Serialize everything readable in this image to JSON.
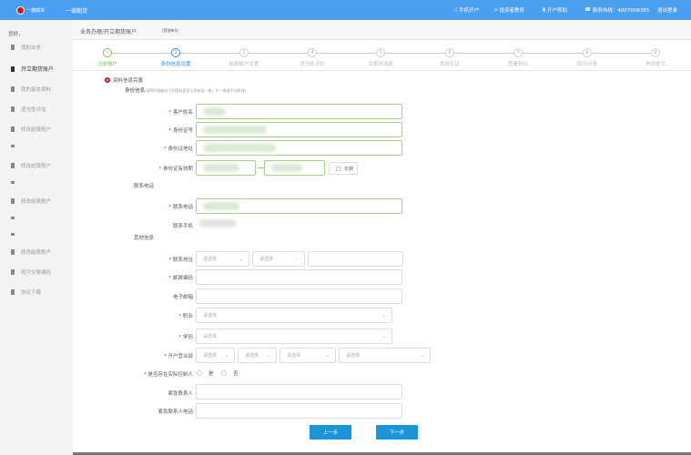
{
  "header": {
    "logo_text": "一德期货",
    "brand": "一德期货",
    "nav": [
      {
        "icon": "mobile-icon",
        "label": "手机开户"
      },
      {
        "icon": "home-icon",
        "label": "投资者教育"
      },
      {
        "icon": "book-icon",
        "label": "开户帮助"
      },
      {
        "icon": "phone-icon",
        "label": "服务热线：4007008365"
      },
      {
        "icon": "",
        "label": "退出登录"
      }
    ]
  },
  "sidebar": {
    "greeting": "您好，",
    "items": [
      {
        "label": "我的业务",
        "type": "normal"
      },
      {
        "label": "开立期货账户",
        "type": "active"
      },
      {
        "label": "我的基本资料",
        "type": "normal"
      },
      {
        "label": "适当性评估",
        "type": "normal"
      },
      {
        "label": "修改结算账户",
        "type": "normal"
      },
      {
        "label": "......",
        "type": "small"
      },
      {
        "label": "修改结算账户",
        "type": "normal"
      },
      {
        "label": "......",
        "type": "small"
      },
      {
        "label": "修改结算账户",
        "type": "normal"
      },
      {
        "label": "......",
        "type": "small"
      },
      {
        "label": "......",
        "type": "small"
      },
      {
        "label": "修改结算账户",
        "type": "normal"
      },
      {
        "label": "增开交易编码",
        "type": "normal"
      },
      {
        "label": "协议下载",
        "type": "normal"
      }
    ]
  },
  "breadcrumb": {
    "path": "业务办理/开立期货账户",
    "note": "[受理单号:"
  },
  "steps": [
    {
      "num": "✓",
      "label": "注册账户",
      "state": "done"
    },
    {
      "num": "2",
      "label": "身份信息设置",
      "state": "current"
    },
    {
      "num": "3",
      "label": "结算账户设置",
      "state": "todo"
    },
    {
      "num": "4",
      "label": "适当性评估",
      "state": "todo"
    },
    {
      "num": "5",
      "label": "交易所选择",
      "state": "todo"
    },
    {
      "num": "6",
      "label": "视频见证",
      "state": "todo"
    },
    {
      "num": "7",
      "label": "签署协议",
      "state": "todo"
    },
    {
      "num": "8",
      "label": "回访问卷",
      "state": "todo"
    },
    {
      "num": "9",
      "label": "申请提交",
      "state": "todo"
    }
  ],
  "form": {
    "alert": "资料信息完善",
    "identity_title": "身份信息",
    "identity_hint": "(请您仔细核对下列资料是否与身份证一致，不一致请手动修改)",
    "name_label": "客户姓名",
    "id_label": "身份证号",
    "address_label": "身份证地址",
    "validity_label": "身份证有效期",
    "validity_sep": "—",
    "long_term_label": "长期",
    "contact_section": "联系电话",
    "phone_label": "联系电话",
    "mobile_label": "联系手机",
    "other_section": "其他信息",
    "contact_address_label": "联系地址",
    "postcode_label": "邮政编码",
    "email_label": "电子邮箱",
    "job_label": "职业",
    "edu_label": "学历",
    "branch_label": "开户营业部",
    "actual_controller_label": "是否存在实际控制人",
    "yes": "是",
    "no": "否",
    "emergency_contact_label": "紧急联系人",
    "emergency_phone_label": "紧急联系人电话",
    "placeholder_select": "请选择"
  },
  "buttons": {
    "prev": "上一步",
    "next": "下一步"
  }
}
